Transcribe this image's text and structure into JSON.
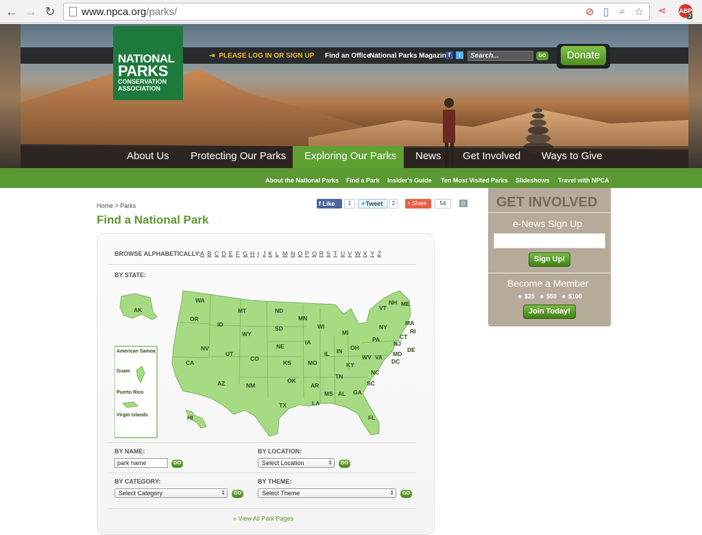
{
  "browser": {
    "url": "www.npca.org/parks/",
    "url_domain": "www.npca.org",
    "url_path": "/parks/",
    "adblock_badge": "ABP",
    "adblock_count": "2"
  },
  "header": {
    "logo_line1": "NATIONAL",
    "logo_line2": "PARKS",
    "logo_line3": "CONSERVATION",
    "logo_line4": "ASSOCIATION",
    "login_text": "PLEASE LOG IN OR SIGN UP",
    "find_office": "Find an Office",
    "magazine": "National Parks Magazine",
    "search_placeholder": "Search...",
    "search_go": "GO",
    "donate": "Donate"
  },
  "main_nav": [
    "About Us",
    "Protecting Our Parks",
    "Exploring Our Parks",
    "News",
    "Get Involved",
    "Ways to Give"
  ],
  "main_nav_active": "Exploring Our Parks",
  "sub_nav": [
    "About the National Parks",
    "Find a Park",
    "Insider's Guide",
    "Ten Most Visited Parks",
    "Slideshows",
    "Travel with NPCA"
  ],
  "breadcrumb": "Home > Parks",
  "share": {
    "like": "Like",
    "like_count": "1",
    "tweet": "Tweet",
    "tweet_count": "2",
    "share": "Share",
    "share_count": "54"
  },
  "page_title": "Find a National Park",
  "finder": {
    "browse_label": "BROWSE ALPHABETICALLY:",
    "letters": [
      "A",
      "B",
      "C",
      "D",
      "E",
      "F",
      "G",
      "H",
      "I",
      "J",
      "K",
      "L",
      "M",
      "N",
      "O",
      "P",
      "Q",
      "R",
      "S",
      "T",
      "U",
      "V",
      "W",
      "X",
      "Y",
      "Z"
    ],
    "state_label": "BY STATE:",
    "territories": [
      "American Samoa",
      "Guam",
      "Puerto Rico",
      "Virgin Islands"
    ],
    "states": [
      "AK",
      "HI",
      "WA",
      "OR",
      "CA",
      "NV",
      "ID",
      "MT",
      "WY",
      "UT",
      "AZ",
      "CO",
      "NM",
      "ND",
      "SD",
      "NE",
      "KS",
      "OK",
      "TX",
      "MN",
      "IA",
      "MO",
      "AR",
      "LA",
      "WI",
      "IL",
      "MS",
      "MI",
      "IN",
      "TN",
      "AL",
      "OH",
      "KY",
      "GA",
      "FL",
      "PA",
      "WV",
      "VA",
      "NC",
      "SC",
      "NY",
      "VT",
      "NH",
      "ME",
      "MA",
      "RI",
      "CT",
      "NJ",
      "DE",
      "MD",
      "DC"
    ],
    "by_name_label": "BY NAME:",
    "name_value": "park name",
    "by_location_label": "BY LOCATION:",
    "location_value": "Select Location",
    "by_category_label": "BY CATEGORY:",
    "category_value": "Select Category",
    "by_theme_label": "BY THEME:",
    "theme_value": "Select Theme",
    "go": "GO",
    "view_all": "» View All Park Pages"
  },
  "sidebar": {
    "title": "GET INVOLVED",
    "enews": "e-News Sign Up",
    "signup": "Sign Up!",
    "member": "Become a Member",
    "amounts": [
      "$25",
      "$50",
      "$100"
    ],
    "join": "Join Today!"
  },
  "colors": {
    "brand_green": "#5a9832",
    "logo_green": "#1e7a3c",
    "login_orange": "#f2b632",
    "sidebar_tan": "#b6aa9b",
    "map_fill": "#a6db84"
  }
}
